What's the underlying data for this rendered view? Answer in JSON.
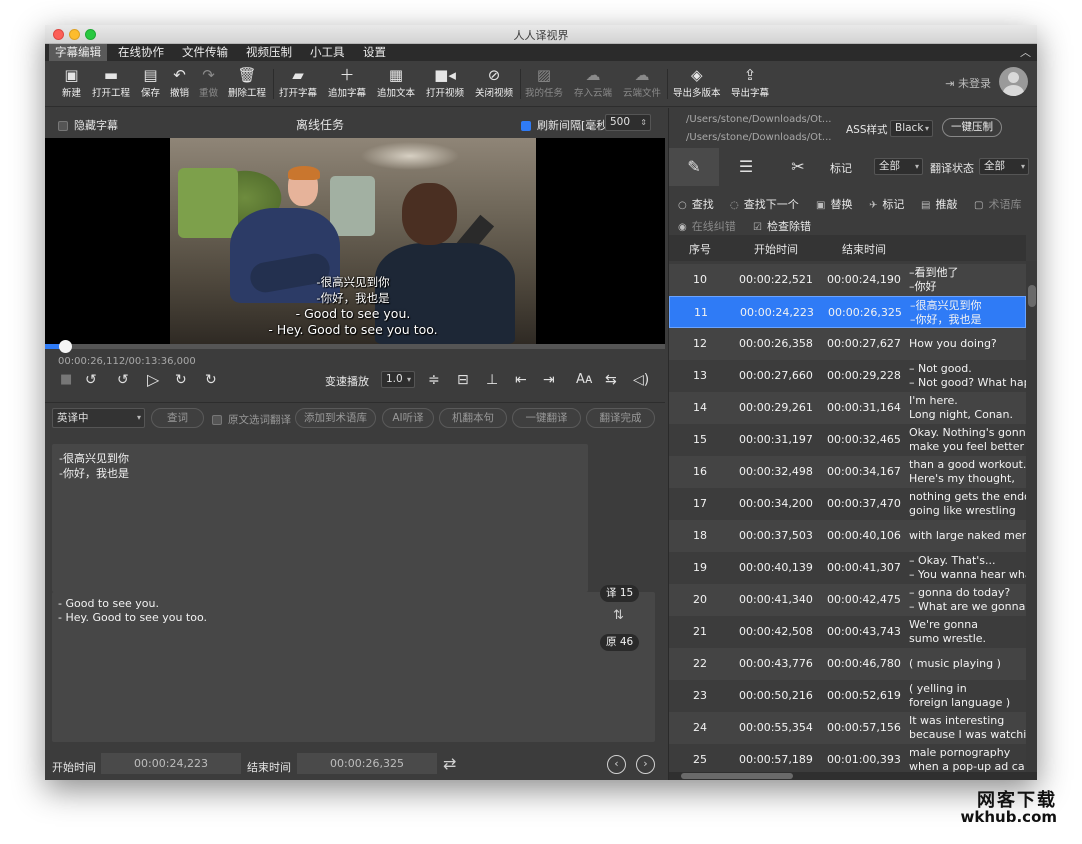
{
  "window": {
    "title": "人人译视界"
  },
  "menu": [
    "字幕编辑",
    "在线协作",
    "文件传输",
    "视频压制",
    "小工具",
    "设置"
  ],
  "toolbar": [
    {
      "label": "新建",
      "icon": "new-file-icon"
    },
    {
      "label": "打开工程",
      "icon": "folder-icon"
    },
    {
      "label": "保存",
      "icon": "save-icon"
    },
    {
      "label": "撤销",
      "icon": "undo-icon"
    },
    {
      "label": "重做",
      "icon": "redo-icon"
    },
    {
      "label": "删除工程",
      "icon": "trash-icon"
    },
    {
      "label": "打开字幕",
      "icon": "folder-open-icon"
    },
    {
      "label": "追加字幕",
      "icon": "plus-icon"
    },
    {
      "label": "追加文本",
      "icon": "text-icon"
    },
    {
      "label": "打开视频",
      "icon": "video-camera-icon"
    },
    {
      "label": "关闭视频",
      "icon": "video-off-icon"
    },
    {
      "label": "我的任务",
      "icon": "clipboard-icon"
    },
    {
      "label": "存入云端",
      "icon": "cloud-icon"
    },
    {
      "label": "云端文件",
      "icon": "cloud-upload-icon"
    },
    {
      "label": "导出多版本",
      "icon": "layers-export-icon"
    },
    {
      "label": "导出字幕",
      "icon": "export-file-icon"
    }
  ],
  "user": {
    "login_label": "未登录"
  },
  "video_panel": {
    "hide_subs_label": "隐藏字幕",
    "title": "离线任务",
    "refresh_label": "刷新间隔[毫秒]",
    "refresh_value": "500",
    "subtitle_lines": [
      "-很高兴见到你",
      "-你好，我也是",
      "- Good to see you.",
      "- Hey. Good to see you too."
    ],
    "timecode": "00:00:26,112/00:13:36,000",
    "progress_fraction": 0.033,
    "speed_label": "变速播放",
    "speed_value": "1.0"
  },
  "editor": {
    "lang_value": "英译中",
    "buttons": {
      "lookup": "查词",
      "select_translate": "原文选词翻译",
      "add_glossary": "添加到术语库",
      "ai_listen": "AI听译",
      "machine_translate": "机翻本句",
      "one_click": "一键翻译",
      "done": "翻译完成"
    },
    "translation_lines": [
      "-很高兴见到你",
      "-你好，我也是"
    ],
    "original_lines": [
      "- Good to see you.",
      "- Hey. Good to see you too."
    ],
    "trans_count": "译 15",
    "orig_count": "原 46",
    "start_label": "开始时间",
    "start_value": "00:00:24,223",
    "end_label": "结束时间",
    "end_value": "00:00:26,325"
  },
  "right_panel": {
    "paths": [
      "/Users/stone/Downloads/Ot...",
      "/Users/stone/Downloads/Ot..."
    ],
    "ass_label": "ASS样式",
    "ass_value": "Black",
    "burn_label": "一键压制",
    "mark_label": "标记",
    "mark_value": "全部",
    "trans_state_label": "翻译状态",
    "trans_state_value": "全部",
    "find": {
      "find": "查找",
      "find_next": "查找下一个",
      "replace": "替换",
      "mark": "标记",
      "revise": "推敲",
      "glossary": "术语库",
      "online_fix": "在线纠错",
      "check_remove": "检查除错"
    },
    "columns": [
      "序号",
      "开始时间",
      "结束时间"
    ],
    "rows": [
      {
        "n": "10",
        "start": "00:00:22,521",
        "end": "00:00:24,190",
        "l1": "–看到他了",
        "l2": "–你好"
      },
      {
        "n": "11",
        "start": "00:00:24,223",
        "end": "00:00:26,325",
        "l1": "–很高兴见到你",
        "l2": "–你好，我也是"
      },
      {
        "n": "12",
        "start": "00:00:26,358",
        "end": "00:00:27,627",
        "l1": "How you doing?",
        "l2": ""
      },
      {
        "n": "13",
        "start": "00:00:27,660",
        "end": "00:00:29,228",
        "l1": "– Not good.",
        "l2": "– Not good? What hap"
      },
      {
        "n": "14",
        "start": "00:00:29,261",
        "end": "00:00:31,164",
        "l1": "I'm here.",
        "l2": "Long night, Conan."
      },
      {
        "n": "15",
        "start": "00:00:31,197",
        "end": "00:00:32,465",
        "l1": "Okay. Nothing's gonn",
        "l2": "make you feel better"
      },
      {
        "n": "16",
        "start": "00:00:32,498",
        "end": "00:00:34,167",
        "l1": "than a good workout.",
        "l2": "Here's my thought,"
      },
      {
        "n": "17",
        "start": "00:00:34,200",
        "end": "00:00:37,470",
        "l1": "nothing gets the endo",
        "l2": "going like wrestling"
      },
      {
        "n": "18",
        "start": "00:00:37,503",
        "end": "00:00:40,106",
        "l1": "with large naked men",
        "l2": ""
      },
      {
        "n": "19",
        "start": "00:00:40,139",
        "end": "00:00:41,307",
        "l1": "– Okay. That's...",
        "l2": "– You wanna hear wha"
      },
      {
        "n": "20",
        "start": "00:00:41,340",
        "end": "00:00:42,475",
        "l1": "– gonna do today?",
        "l2": "– What are we gonna"
      },
      {
        "n": "21",
        "start": "00:00:42,508",
        "end": "00:00:43,743",
        "l1": "We're gonna",
        "l2": "sumo wrestle."
      },
      {
        "n": "22",
        "start": "00:00:43,776",
        "end": "00:00:46,780",
        "l1": "( music playing )",
        "l2": ""
      },
      {
        "n": "23",
        "start": "00:00:50,216",
        "end": "00:00:52,619",
        "l1": "( yelling in",
        "l2": "foreign language )"
      },
      {
        "n": "24",
        "start": "00:00:55,354",
        "end": "00:00:57,156",
        "l1": "It was interesting",
        "l2": "because I was watchin"
      },
      {
        "n": "25",
        "start": "00:00:57,189",
        "end": "00:01:00,393",
        "l1": "male pornography",
        "l2": "when a pop-up ad ca"
      }
    ],
    "selected_row": "11"
  },
  "watermark": {
    "line1": "网客下载",
    "line2": "wkhub.com"
  }
}
